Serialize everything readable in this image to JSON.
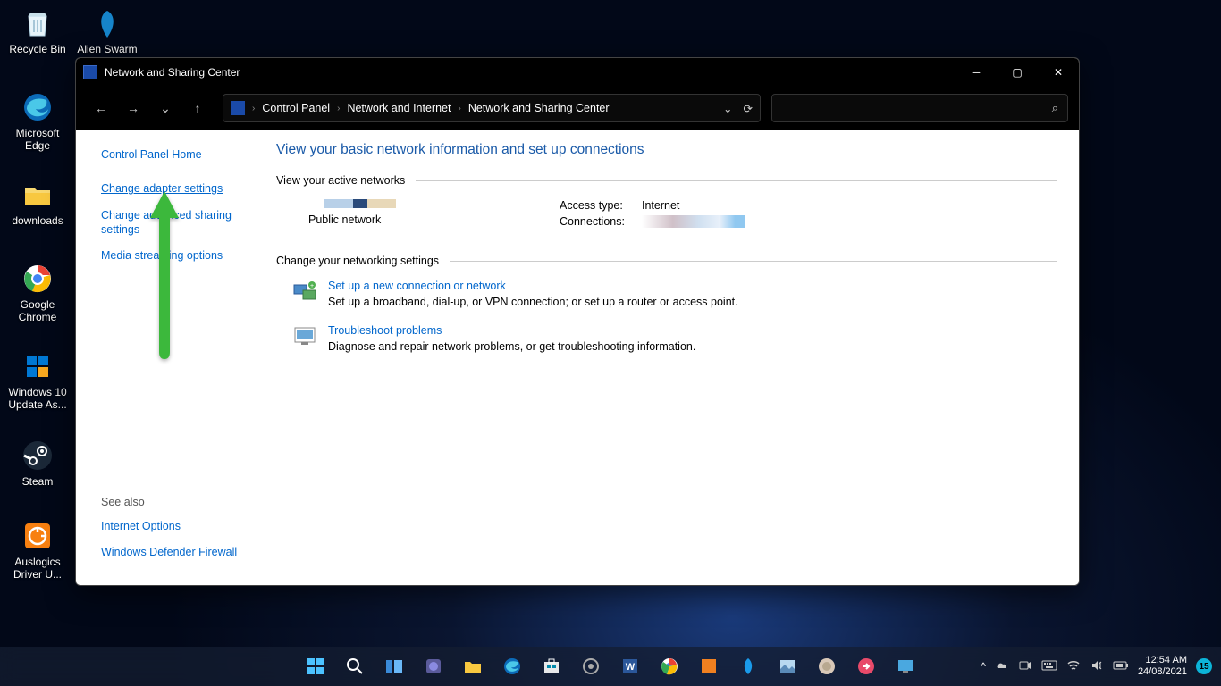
{
  "desktop": {
    "icons": [
      {
        "label": "Recycle Bin"
      },
      {
        "label": "Alien Swarm"
      },
      {
        "label": "Microsoft Edge"
      },
      {
        "label": "downloads"
      },
      {
        "label": "Google Chrome"
      },
      {
        "label": "Windows 10 Update As..."
      },
      {
        "label": "Steam"
      },
      {
        "label": "Auslogics Driver U..."
      }
    ]
  },
  "window": {
    "title": "Network and Sharing Center",
    "breadcrumbs": [
      "Control Panel",
      "Network and Internet",
      "Network and Sharing Center"
    ]
  },
  "sidebar": {
    "home": "Control Panel Home",
    "links": [
      "Change adapter settings",
      "Change advanced sharing settings",
      "Media streaming options"
    ],
    "see_also_header": "See also",
    "see_also": [
      "Internet Options",
      "Windows Defender Firewall"
    ]
  },
  "main": {
    "heading": "View your basic network information and set up connections",
    "active_networks_header": "View your active networks",
    "public_network_label": "Public network",
    "access_type_label": "Access type:",
    "access_type_value": "Internet",
    "connections_label": "Connections:",
    "change_settings_header": "Change your networking settings",
    "items": [
      {
        "link": "Set up a new connection or network",
        "desc": "Set up a broadband, dial-up, or VPN connection; or set up a router or access point."
      },
      {
        "link": "Troubleshoot problems",
        "desc": "Diagnose and repair network problems, or get troubleshooting information."
      }
    ]
  },
  "taskbar": {
    "time": "12:54 AM",
    "date": "24/08/2021",
    "badge": "15"
  }
}
